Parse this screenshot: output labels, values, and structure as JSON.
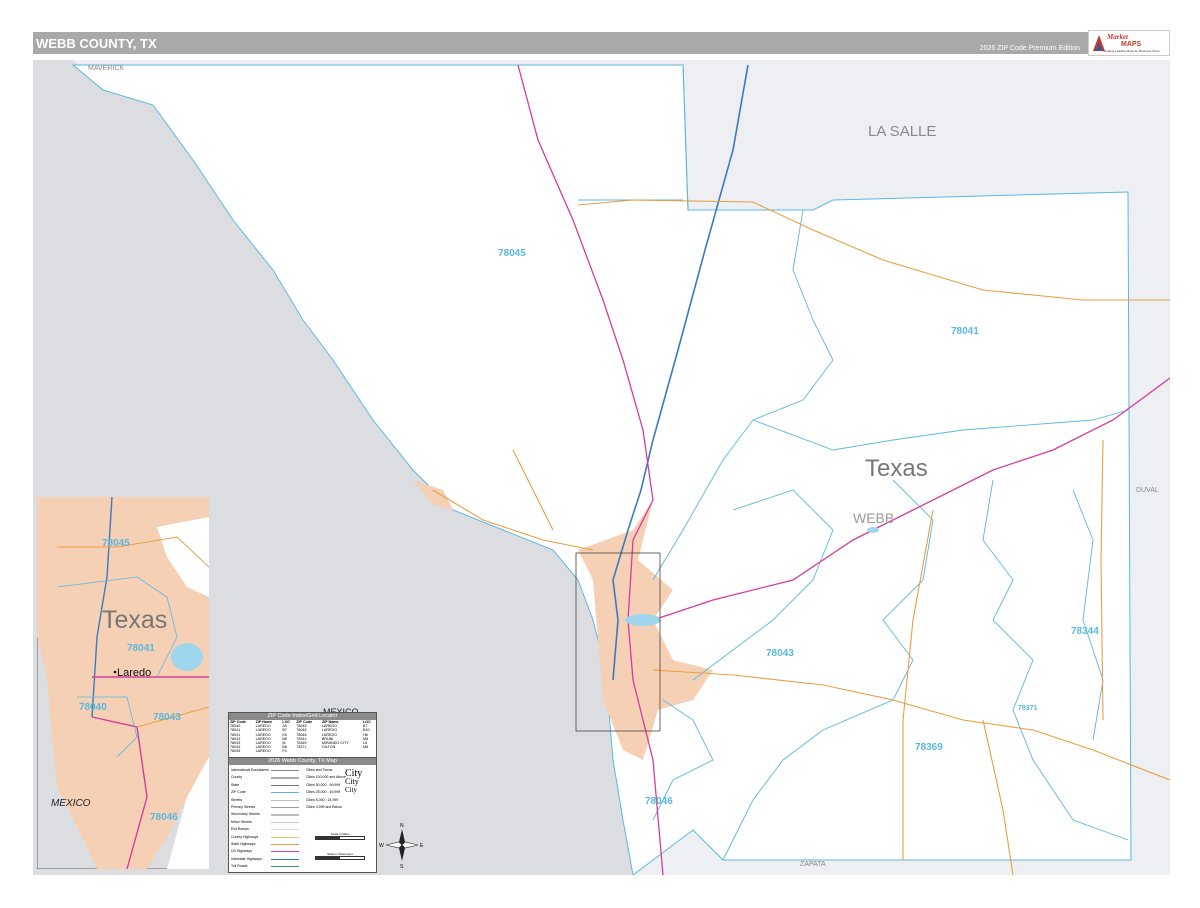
{
  "header": {
    "title": "WEBB COUNTY, TX",
    "edition": "2026 ZIP Code Premium Edition"
  },
  "logo": {
    "brand": "Market",
    "brand2": "MAPS",
    "tagline": "Creating Leading Maps for Business Since"
  },
  "map": {
    "colors": {
      "mexico": "#dcdde0",
      "neighbor": "#eeeff2",
      "county": "#ffffff",
      "urban": "#f6d0b5",
      "zip_line": "#5ab8e0",
      "interstate": "#3a7bbf",
      "us_highway": "#d63c9e",
      "state_highway": "#e8a040"
    },
    "labels": {
      "maverick": "MAVERICK",
      "la_salle": "LA SALLE",
      "duval": "DUVAL",
      "zapata": "ZAPATA",
      "mexico_main": "MEXICO",
      "texas": "Texas",
      "webb": "WEBB"
    },
    "zips": {
      "z78045": "78045",
      "z78041": "78041",
      "z78043": "78043",
      "z78344": "78344",
      "z78369": "78369",
      "z78046": "78046",
      "z78371": "78371"
    },
    "inset": {
      "texas": "Texas",
      "city": "Laredo",
      "mexico": "MEXICO",
      "z78045": "78045",
      "z78041": "78041",
      "z78040": "78040",
      "z78043": "78043",
      "z78046": "78046"
    },
    "zip_index": {
      "title": "ZIP Code Index/Grid Locator",
      "headers": [
        "ZIP Code",
        "ZIP Name",
        "LOC",
        "ZIP Code",
        "ZIP Name",
        "LOC"
      ],
      "rows": [
        [
          "78040",
          "LAREDO",
          "A9",
          "78045",
          "LAREDO",
          "B7"
        ],
        [
          "78041",
          "LAREDO",
          "B7",
          "78046",
          "LAREDO",
          "B10"
        ],
        [
          "78041",
          "LAREDO",
          "K5",
          "78048",
          "LAREDO",
          "H8"
        ],
        [
          "78043",
          "LAREDO",
          "B8",
          "78344",
          "BRUNI",
          "M8"
        ],
        [
          "78043",
          "LAREDO",
          "I8",
          "78369",
          "MIRANDO CITY",
          "L8"
        ],
        [
          "78044",
          "LAREDO",
          "B8",
          "78371",
          "OILTON",
          "M8"
        ],
        [
          "78045",
          "LAREDO",
          "F4",
          "",
          "",
          ""
        ]
      ]
    },
    "legend": {
      "title": "2026 Webb County, TX Map",
      "items_left": [
        "International Boundaries",
        "County",
        "State",
        "ZIP Code",
        "Streets",
        "Primary Streets",
        "Secondary Streets",
        "Minor Streets",
        "Exit Ramps",
        "County Highways",
        "State Highways",
        "US Highways",
        "Interstate Highways",
        "Toll Roads"
      ],
      "items_right": [
        "Cities and Towns",
        "Cities 100,000 and Above",
        "Cities 50,000 - 99,999",
        "Cities 25,000 - 49,999",
        "Cities 5,000 - 24,999",
        "Cities 4,999 and Below"
      ],
      "city_samples": [
        "City",
        "City",
        "City",
        "City",
        "City"
      ],
      "scale_miles": "Scale in Miles",
      "scale_km": "Scale in Kilometers"
    },
    "compass": {
      "n": "N",
      "s": "S",
      "e": "E",
      "w": "W"
    }
  }
}
